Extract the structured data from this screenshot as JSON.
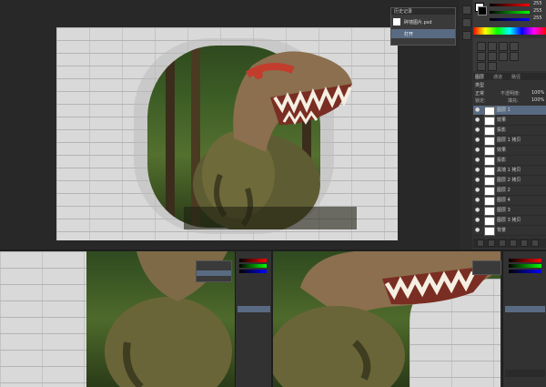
{
  "history_panel": {
    "title": "历史记录",
    "items": [
      {
        "label": "碎墙图片.psd"
      },
      {
        "label": "打开"
      }
    ]
  },
  "layers_panel": {
    "tabs": [
      "图层",
      "通道",
      "路径"
    ],
    "kind_label": "类型",
    "blend_mode": "正常",
    "opacity_label": "不透明度:",
    "opacity_value": "100%",
    "fill_label": "填充:",
    "fill_value": "100%",
    "lock_label": "锁定:",
    "layers": [
      {
        "name": "图层 1",
        "selected": true
      },
      {
        "name": "效果",
        "selected": false
      },
      {
        "name": "投影",
        "selected": false
      },
      {
        "name": "图层 1 拷贝",
        "selected": false
      },
      {
        "name": "效果",
        "selected": false
      },
      {
        "name": "投影",
        "selected": false
      },
      {
        "name": "黑墙 1 拷贝",
        "selected": false
      },
      {
        "name": "图层 2 拷贝",
        "selected": false
      },
      {
        "name": "图层 2",
        "selected": false
      },
      {
        "name": "图层 4",
        "selected": false
      },
      {
        "name": "图层 3",
        "selected": false
      },
      {
        "name": "图层 3 拷贝",
        "selected": false
      },
      {
        "name": "背景",
        "selected": false
      }
    ]
  },
  "colors": {
    "app_bg": "#282828",
    "panel_bg": "#323232",
    "selection": "#596b82",
    "wall": "#d9d9d9"
  },
  "color_panel": {
    "r_value": "255",
    "g_value": "255",
    "b_value": "255"
  }
}
